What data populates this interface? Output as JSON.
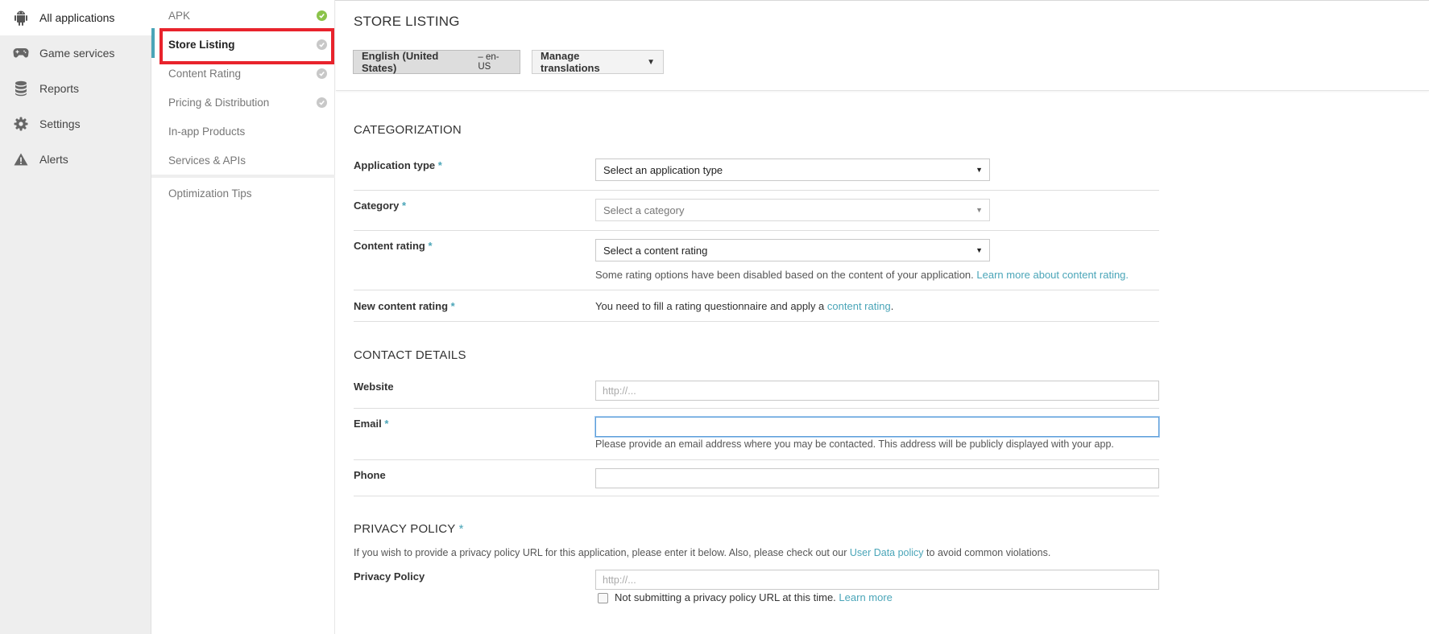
{
  "left_nav": {
    "items": [
      {
        "label": "All applications",
        "icon": "android-icon",
        "active": true
      },
      {
        "label": "Game services",
        "icon": "gamepad-icon"
      },
      {
        "label": "Reports",
        "icon": "database-icon"
      },
      {
        "label": "Settings",
        "icon": "gear-icon"
      },
      {
        "label": "Alerts",
        "icon": "warning-icon"
      }
    ]
  },
  "sub_nav": {
    "items": [
      {
        "label": "APK",
        "status": "complete"
      },
      {
        "label": "Store Listing",
        "status": "incomplete",
        "active": true
      },
      {
        "label": "Content Rating",
        "status": "incomplete"
      },
      {
        "label": "Pricing & Distribution",
        "status": "incomplete"
      },
      {
        "label": "In-app Products"
      },
      {
        "label": "Services & APIs"
      }
    ],
    "extra": {
      "label": "Optimization Tips"
    }
  },
  "header": {
    "title": "STORE LISTING",
    "language_button": "English (United States)",
    "language_code": "– en-US",
    "translations_button": "Manage translations",
    "translations_caret": "▼"
  },
  "categorization": {
    "title": "CATEGORIZATION",
    "app_type": {
      "label": "Application type",
      "required": "*",
      "value": "Select an application type"
    },
    "category": {
      "label": "Category",
      "required": "*",
      "value": "Select a category"
    },
    "content_rating": {
      "label": "Content rating",
      "required": "*",
      "value": "Select a content rating",
      "help": "Some rating options have been disabled based on the content of your application.",
      "help_link": "Learn more about content rating."
    },
    "new_content_rating": {
      "label": "New content rating",
      "required": "*",
      "text": "You need to fill a rating questionnaire and apply a",
      "link": "content rating",
      "after": "."
    }
  },
  "contact": {
    "title": "CONTACT DETAILS",
    "website": {
      "label": "Website",
      "placeholder": "http://..."
    },
    "email": {
      "label": "Email",
      "required": "*",
      "value": "",
      "help": "Please provide an email address where you may be contacted. This address will be publicly displayed with your app."
    },
    "phone": {
      "label": "Phone",
      "value": ""
    }
  },
  "privacy": {
    "title": "PRIVACY POLICY",
    "required": "*",
    "intro": "If you wish to provide a privacy policy URL for this application, please enter it below. Also, please check out our",
    "intro_link": "User Data policy",
    "intro_after": "to avoid common violations.",
    "field": {
      "label": "Privacy Policy",
      "placeholder": "http://..."
    },
    "checkbox_label": "Not submitting a privacy policy URL at this time.",
    "checkbox_link": "Learn more",
    "checked": false
  },
  "colors": {
    "accent": "#4aa5b8",
    "complete": "#8bc34a",
    "highlight": "#e8232c"
  }
}
